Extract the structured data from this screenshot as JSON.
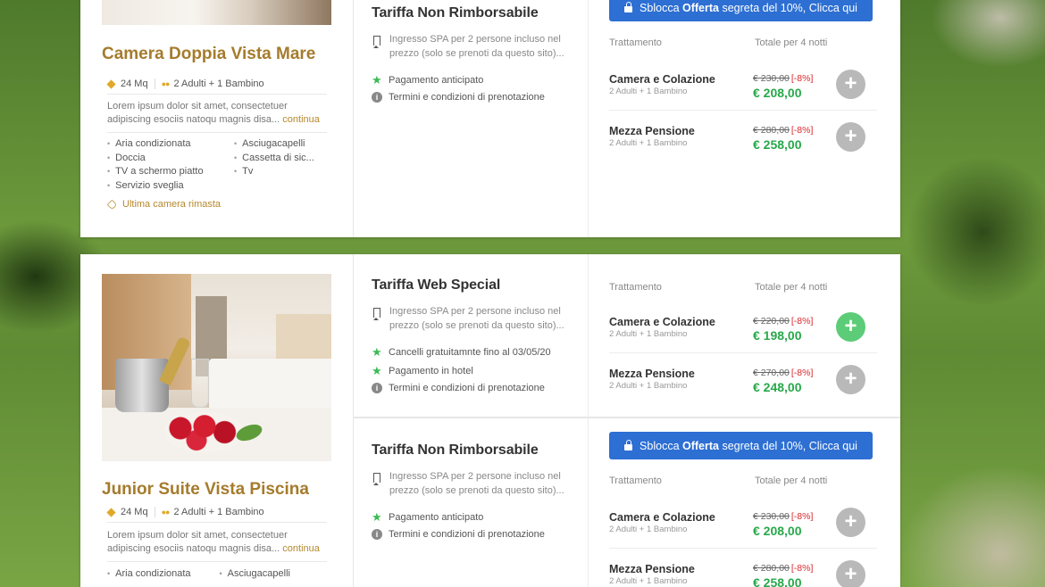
{
  "rooms": [
    {
      "title": "Camera Doppia Vista Mare",
      "size": "24 Mq",
      "guests": "2 Adulti + 1 Bambino",
      "desc": "Lorem ipsum dolor sit amet, consectetuer adipiscing esociis natoqu magnis disa...",
      "more": "continua",
      "features_left": [
        "Aria condizionata",
        "Doccia",
        "TV a schermo piatto",
        "Servizio sveglia"
      ],
      "features_right": [
        "Asciugacapelli",
        "Cassetta di sic...",
        "Tv"
      ],
      "notice": "Ultima camera rimasta",
      "rates": [
        {
          "name": "Tariffa Non Rimborsabile",
          "included": "Ingresso SPA per 2 persone incluso nel prezzo (solo se prenoti da questo sito)...",
          "conditions": [
            "Pagamento anticipato"
          ],
          "terms": "Termini e condizioni di prenotazione",
          "unlock_prefix": "Sblocca ",
          "unlock_bold": "Offerta",
          "unlock_suffix": " segreta del 10%, Clicca qui",
          "col_treatment": "Trattamento",
          "col_total": "Totale per 4 notti",
          "options": [
            {
              "name": "Camera e Colazione",
              "guests": "2 Adulti + 1 Bambino",
              "old": "€ 230,00",
              "discount": "[-8%]",
              "price": "€ 208,00"
            },
            {
              "name": "Mezza Pensione",
              "guests": "2 Adulti + 1 Bambino",
              "old": "€ 280,00",
              "discount": "[-8%]",
              "price": "€ 258,00"
            }
          ]
        }
      ]
    },
    {
      "title": "Junior Suite Vista Piscina",
      "size": "24 Mq",
      "guests": "2 Adulti + 1 Bambino",
      "desc": "Lorem ipsum dolor sit amet, consectetuer adipiscing esociis natoqu magnis disa...",
      "more": "continua",
      "features_left": [
        "Aria condizionata"
      ],
      "features_right": [
        "Asciugacapelli"
      ],
      "rates": [
        {
          "name": "Tariffa Web Special",
          "included": "Ingresso SPA per 2 persone incluso nel prezzo (solo se prenoti da questo sito)...",
          "conditions": [
            "Cancelli gratuitamnte fino al 03/05/20",
            "Pagamento in hotel"
          ],
          "terms": "Termini e condizioni di prenotazione",
          "col_treatment": "Trattamento",
          "col_total": "Totale per 4 notti",
          "options": [
            {
              "name": "Camera e Colazione",
              "guests": "2 Adulti + 1 Bambino",
              "old": "€ 220,00",
              "discount": "[-8%]",
              "price": "€ 198,00"
            },
            {
              "name": "Mezza Pensione",
              "guests": "2 Adulti + 1 Bambino",
              "old": "€ 270,00",
              "discount": "[-8%]",
              "price": "€ 248,00"
            }
          ]
        },
        {
          "name": "Tariffa Non Rimborsabile",
          "included": "Ingresso SPA per 2 persone incluso nel prezzo (solo se prenoti da questo sito)...",
          "conditions": [
            "Pagamento anticipato"
          ],
          "terms": "Termini e condizioni di prenotazione",
          "unlock_prefix": "Sblocca ",
          "unlock_bold": "Offerta",
          "unlock_suffix": " segreta del 10%, Clicca qui",
          "col_treatment": "Trattamento",
          "col_total": "Totale per 4 notti",
          "options": [
            {
              "name": "Camera e Colazione",
              "guests": "2 Adulti + 1 Bambino",
              "old": "€ 230,00",
              "discount": "[-8%]",
              "price": "€ 208,00"
            },
            {
              "name": "Mezza Pensione",
              "guests": "2 Adulti + 1 Bambino",
              "old": "€ 280,00",
              "discount": "[-8%]",
              "price": "€ 258,00"
            }
          ]
        }
      ]
    }
  ],
  "colors": {
    "gold": "#a57b2c",
    "price_green": "#27a84a",
    "discount_red": "#d9292f",
    "unlock_blue": "#2d6fd3",
    "add_active": "#5ccc78"
  },
  "icons": {
    "size": "cube-icon",
    "guests": "people-icon",
    "included": "bookmark-icon",
    "condition": "star-icon",
    "terms": "info-icon",
    "unlock": "lock-icon",
    "notice": "tag-icon",
    "add": "plus-icon"
  }
}
